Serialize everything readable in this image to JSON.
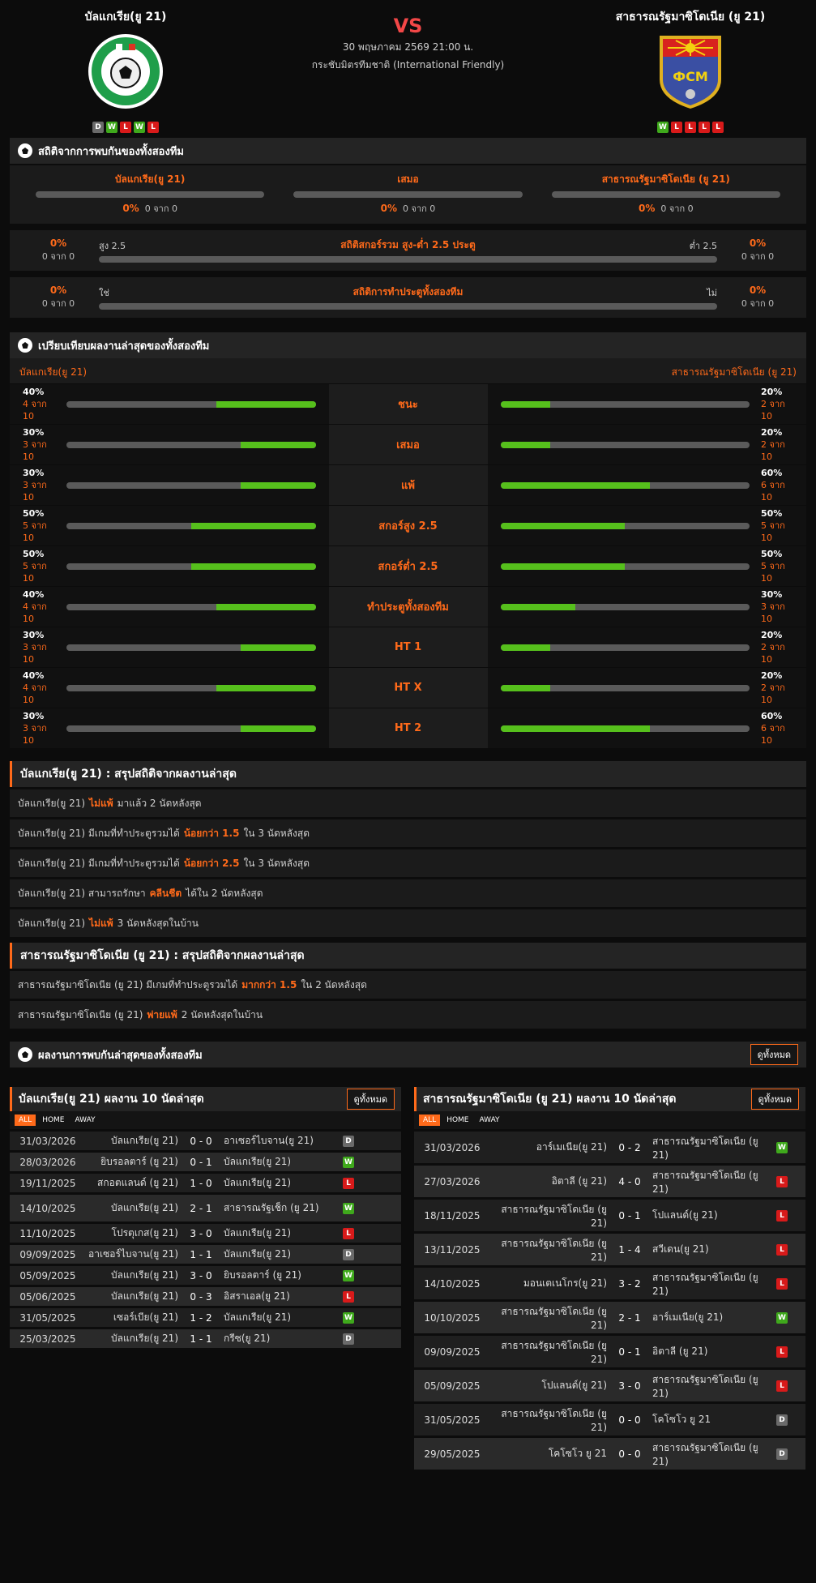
{
  "header": {
    "home_name": "บัลแกเรีย(ยู 21)",
    "away_name": "สาธารณรัฐมาซิโดเนีย (ยู 21)",
    "vs": "VS",
    "date": "30 พฤษภาคม 2569 21:00 น.",
    "league": "กระชับมิตรทีมชาติ (International Friendly)",
    "home_form": [
      "D",
      "W",
      "L",
      "W",
      "L"
    ],
    "away_form": [
      "W",
      "L",
      "L",
      "L",
      "L"
    ],
    "away_crest_text": "ФСМ"
  },
  "h2h": {
    "title": "สถิติจากการพบกันของทั้งสองทีม",
    "cols": [
      {
        "label": "บัลแกเรีย(ยู 21)",
        "pct": "0%",
        "of": "0 จาก 0",
        "fill": 0
      },
      {
        "label": "เสมอ",
        "pct": "0%",
        "of": "0 จาก 0",
        "fill": 0
      },
      {
        "label": "สาธารณรัฐมาซิโดเนีย (ยู 21)",
        "pct": "0%",
        "of": "0 จาก 0",
        "fill": 0
      }
    ],
    "ou": {
      "title": "สถิติสกอร์รวม สูง-ต่ำ 2.5 ประตู",
      "left_label": "สูง 2.5",
      "right_label": "ต่ำ 2.5",
      "left_pct": "0%",
      "left_of": "0 จาก 0",
      "right_pct": "0%",
      "right_of": "0 จาก 0"
    },
    "bt": {
      "title": "สถิติการทำประตูทั้งสองทีม",
      "left_label": "ใช่",
      "right_label": "ไม่",
      "left_pct": "0%",
      "left_of": "0 จาก 0",
      "right_pct": "0%",
      "right_of": "0 จาก 0"
    }
  },
  "compare": {
    "title": "เปรียบเทียบผลงานล่าสุดของทั้งสองทีม",
    "home": "บัลแกเรีย(ยู 21)",
    "away": "สาธารณรัฐมาซิโดเนีย (ยู 21)",
    "rows": [
      {
        "label": "ชนะ",
        "hp": "40%",
        "hc": "4 จาก 10",
        "hv": 0.4,
        "ap": "20%",
        "ac": "2 จาก 10",
        "av": 0.2
      },
      {
        "label": "เสมอ",
        "hp": "30%",
        "hc": "3 จาก 10",
        "hv": 0.3,
        "ap": "20%",
        "ac": "2 จาก 10",
        "av": 0.2
      },
      {
        "label": "แพ้",
        "hp": "30%",
        "hc": "3 จาก 10",
        "hv": 0.3,
        "ap": "60%",
        "ac": "6 จาก 10",
        "av": 0.6
      },
      {
        "label": "สกอร์สูง 2.5",
        "hp": "50%",
        "hc": "5 จาก 10",
        "hv": 0.5,
        "ap": "50%",
        "ac": "5 จาก 10",
        "av": 0.5
      },
      {
        "label": "สกอร์ต่ำ 2.5",
        "hp": "50%",
        "hc": "5 จาก 10",
        "hv": 0.5,
        "ap": "50%",
        "ac": "5 จาก 10",
        "av": 0.5
      },
      {
        "label": "ทำประตูทั้งสองทีม",
        "hp": "40%",
        "hc": "4 จาก 10",
        "hv": 0.4,
        "ap": "30%",
        "ac": "3 จาก 10",
        "av": 0.3
      },
      {
        "label": "HT 1",
        "hp": "30%",
        "hc": "3 จาก 10",
        "hv": 0.3,
        "ap": "20%",
        "ac": "2 จาก 10",
        "av": 0.2
      },
      {
        "label": "HT X",
        "hp": "40%",
        "hc": "4 จาก 10",
        "hv": 0.4,
        "ap": "20%",
        "ac": "2 จาก 10",
        "av": 0.2
      },
      {
        "label": "HT 2",
        "hp": "30%",
        "hc": "3 จาก 10",
        "hv": 0.3,
        "ap": "60%",
        "ac": "6 จาก 10",
        "av": 0.6
      }
    ]
  },
  "home_summary": {
    "title": "บัลแกเรีย(ยู 21) : สรุปสถิติจากผลงานล่าสุด",
    "rows": [
      {
        "pre": "บัลแกเรีย(ยู 21)",
        "hl": "ไม่แพ้",
        "post": "มาแล้ว 2 นัดหลังสุด"
      },
      {
        "pre": "บัลแกเรีย(ยู 21) มีเกมที่ทำประตูรวมได้",
        "hl": "น้อยกว่า 1.5",
        "post": "ใน 3 นัดหลังสุด"
      },
      {
        "pre": "บัลแกเรีย(ยู 21) มีเกมที่ทำประตูรวมได้",
        "hl": "น้อยกว่า 2.5",
        "post": "ใน 3 นัดหลังสุด"
      },
      {
        "pre": "บัลแกเรีย(ยู 21) สามารถรักษา",
        "hl": "คลีนชีต",
        "post": "ได้ใน 2 นัดหลังสุด"
      },
      {
        "pre": "บัลแกเรีย(ยู 21)",
        "hl": "ไม่แพ้",
        "post": "3 นัดหลังสุดในบ้าน"
      }
    ]
  },
  "away_summary": {
    "title": "สาธารณรัฐมาซิโดเนีย (ยู 21) : สรุปสถิติจากผลงานล่าสุด",
    "rows": [
      {
        "pre": "สาธารณรัฐมาซิโดเนีย (ยู 21) มีเกมที่ทำประตูรวมได้",
        "hl": "มากกว่า 1.5",
        "post": "ใน 2 นัดหลังสุด"
      },
      {
        "pre": "สาธารณรัฐมาซิโดเนีย (ยู 21)",
        "hl": "พ่ายแพ้",
        "post": "2 นัดหลังสุดในบ้าน"
      }
    ]
  },
  "recent": {
    "title": "ผลงานการพบกันล่าสุดของทั้งสองทีม",
    "view_all": "ดูทั้งหมด"
  },
  "home_table": {
    "title": "บัลแกเรีย(ยู 21) ผลงาน 10 นัดล่าสุด",
    "view_all": "ดูทั้งหมด",
    "tabs": [
      "ALL",
      "HOME",
      "AWAY"
    ],
    "rows": [
      {
        "date": "31/03/2026",
        "home": "บัลแกเรีย(ยู 21)",
        "score": "0 - 0",
        "away": "อาเซอร์ไบจาน(ยู 21)",
        "res": "D"
      },
      {
        "date": "28/03/2026",
        "home": "ยิบรอลตาร์ (ยู 21)",
        "score": "0 - 1",
        "away": "บัลแกเรีย(ยู 21)",
        "res": "W"
      },
      {
        "date": "19/11/2025",
        "home": "สกอตแลนด์ (ยู 21)",
        "score": "1 - 0",
        "away": "บัลแกเรีย(ยู 21)",
        "res": "L"
      },
      {
        "date": "14/10/2025",
        "home": "บัลแกเรีย(ยู 21)",
        "score": "2 - 1",
        "away": "สาธารณรัฐเช็ก (ยู 21)",
        "res": "W"
      },
      {
        "date": "11/10/2025",
        "home": "โปรตุเกส(ยู 21)",
        "score": "3 - 0",
        "away": "บัลแกเรีย(ยู 21)",
        "res": "L"
      },
      {
        "date": "09/09/2025",
        "home": "อาเซอร์ไบจาน(ยู 21)",
        "score": "1 - 1",
        "away": "บัลแกเรีย(ยู 21)",
        "res": "D"
      },
      {
        "date": "05/09/2025",
        "home": "บัลแกเรีย(ยู 21)",
        "score": "3 - 0",
        "away": "ยิบรอลตาร์ (ยู 21)",
        "res": "W"
      },
      {
        "date": "05/06/2025",
        "home": "บัลแกเรีย(ยู 21)",
        "score": "0 - 3",
        "away": "อิสราเอล(ยู 21)",
        "res": "L"
      },
      {
        "date": "31/05/2025",
        "home": "เซอร์เบีย(ยู 21)",
        "score": "1 - 2",
        "away": "บัลแกเรีย(ยู 21)",
        "res": "W"
      },
      {
        "date": "25/03/2025",
        "home": "บัลแกเรีย(ยู 21)",
        "score": "1 - 1",
        "away": "กรีซ(ยู 21)",
        "res": "D"
      }
    ]
  },
  "away_table": {
    "title": "สาธารณรัฐมาซิโดเนีย (ยู 21) ผลงาน 10 นัดล่าสุด",
    "view_all": "ดูทั้งหมด",
    "tabs": [
      "ALL",
      "HOME",
      "AWAY"
    ],
    "rows": [
      {
        "date": "31/03/2026",
        "home": "อาร์เมเนีย(ยู 21)",
        "score": "0 - 2",
        "away": "สาธารณรัฐมาซิโดเนีย (ยู 21)",
        "res": "W"
      },
      {
        "date": "27/03/2026",
        "home": "อิตาลี (ยู 21)",
        "score": "4 - 0",
        "away": "สาธารณรัฐมาซิโดเนีย (ยู 21)",
        "res": "L"
      },
      {
        "date": "18/11/2025",
        "home": "สาธารณรัฐมาซิโดเนีย (ยู 21)",
        "score": "0 - 1",
        "away": "โปแลนด์(ยู 21)",
        "res": "L"
      },
      {
        "date": "13/11/2025",
        "home": "สาธารณรัฐมาซิโดเนีย (ยู 21)",
        "score": "1 - 4",
        "away": "สวีเดน(ยู 21)",
        "res": "L"
      },
      {
        "date": "14/10/2025",
        "home": "มอนเตเนโกร(ยู 21)",
        "score": "3 - 2",
        "away": "สาธารณรัฐมาซิโดเนีย (ยู 21)",
        "res": "L"
      },
      {
        "date": "10/10/2025",
        "home": "สาธารณรัฐมาซิโดเนีย (ยู 21)",
        "score": "2 - 1",
        "away": "อาร์เมเนีย(ยู 21)",
        "res": "W"
      },
      {
        "date": "09/09/2025",
        "home": "สาธารณรัฐมาซิโดเนีย (ยู 21)",
        "score": "0 - 1",
        "away": "อิตาลี (ยู 21)",
        "res": "L"
      },
      {
        "date": "05/09/2025",
        "home": "โปแลนด์(ยู 21)",
        "score": "3 - 0",
        "away": "สาธารณรัฐมาซิโดเนีย (ยู 21)",
        "res": "L"
      },
      {
        "date": "31/05/2025",
        "home": "สาธารณรัฐมาซิโดเนีย (ยู 21)",
        "score": "0 - 0",
        "away": "โคโซโว ยู 21",
        "res": "D"
      },
      {
        "date": "29/05/2025",
        "home": "โคโซโว ยู 21",
        "score": "0 - 0",
        "away": "สาธารณรัฐมาซิโดเนีย (ยู 21)",
        "res": "D"
      }
    ]
  }
}
